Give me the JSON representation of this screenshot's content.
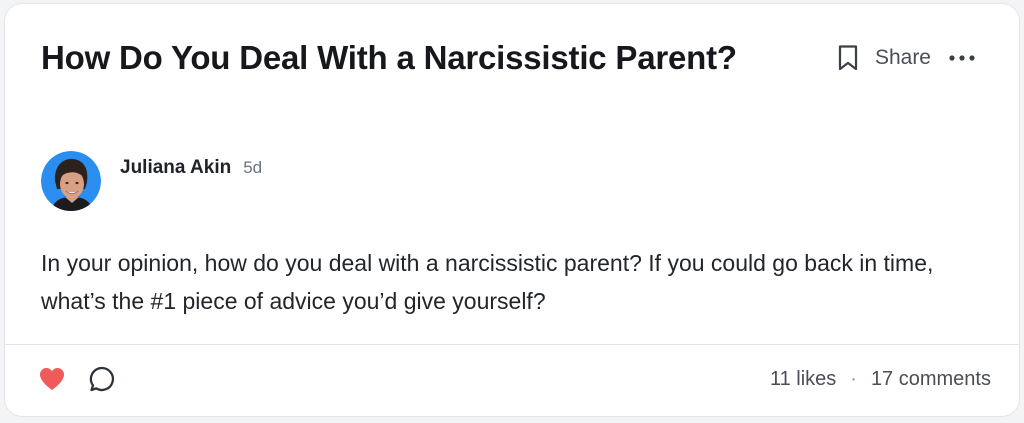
{
  "post": {
    "title": "How Do You Deal With a Narcissistic Parent?",
    "author": "Juliana Akin",
    "age": "5d",
    "body": "In your opinion, how do you deal with a narcissistic parent? If you could go back in time, what’s the #1 piece of advice you’d give yourself?"
  },
  "actions": {
    "bookmark_icon": "bookmark-icon",
    "share_label": "Share",
    "more_icon": "more-horizontal-icon"
  },
  "footer": {
    "like_icon": "heart-icon",
    "comment_icon": "comment-icon",
    "likes_text": "11 likes",
    "separator": "·",
    "comments_text": "17 comments"
  },
  "colors": {
    "heart": "#ef5a5a",
    "avatar_bg": "#2a8df0"
  }
}
